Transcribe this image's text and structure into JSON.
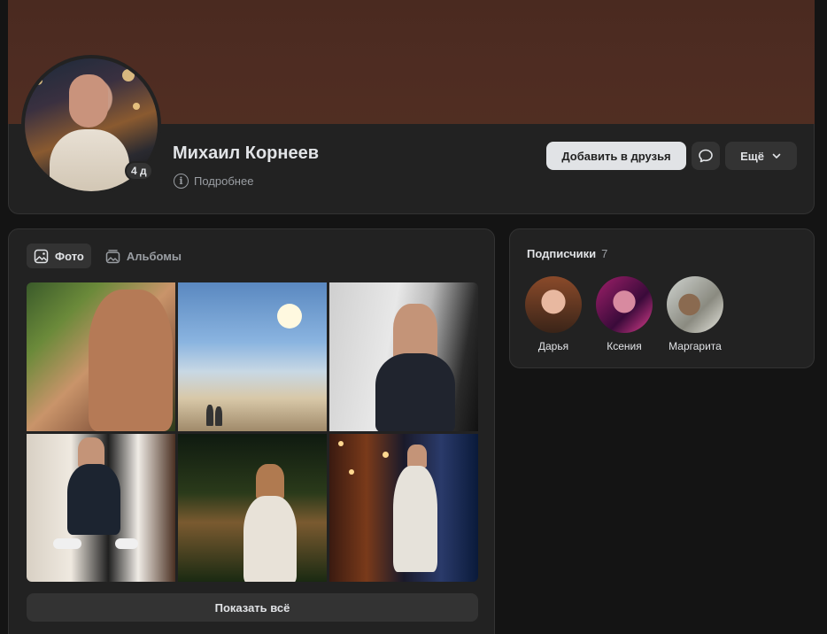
{
  "profile": {
    "name": "Михаил Корнеев",
    "online_badge": "4 д",
    "details_label": "Подробнее",
    "add_friend_label": "Добавить в друзья",
    "more_label": "Ещё"
  },
  "photos": {
    "tabs": [
      {
        "label": "Фото",
        "active": true
      },
      {
        "label": "Альбомы",
        "active": false
      }
    ],
    "show_all_label": "Показать всё"
  },
  "followers": {
    "title": "Подписчики",
    "count": "7",
    "items": [
      {
        "name": "Дарья"
      },
      {
        "name": "Ксения"
      },
      {
        "name": "Маргарита"
      }
    ]
  },
  "colors": {
    "background": "#141414",
    "card": "#222222",
    "button_secondary": "#333333",
    "button_primary": "#e1e3e6",
    "text_primary": "#e1e3e6",
    "text_secondary": "#9a9ea3",
    "cover": "#4e2c22"
  },
  "icons": {
    "details": "info-icon",
    "message": "message-bubble-icon",
    "more": "chevron-down-icon",
    "photos_tab": "image-icon",
    "albums_tab": "album-stack-icon"
  }
}
